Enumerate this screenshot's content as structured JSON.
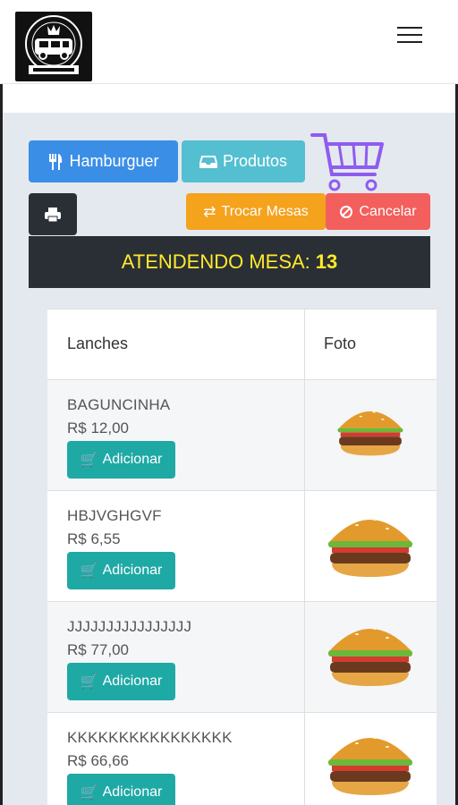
{
  "header": {
    "logo_icon": "food-truck-logo",
    "menu_icon": "hamburger-menu-icon"
  },
  "toolbar": {
    "hamburger_label": "Hamburguer",
    "produtos_label": "Produtos",
    "trocar_label": "Trocar Mesas",
    "cancelar_label": "Cancelar",
    "cart_icon": "shopping-cart-icon",
    "print_icon": "printer-icon"
  },
  "banner": {
    "label": "ATENDENDO MESA:",
    "table_number": "13"
  },
  "table": {
    "col_lanches": "Lanches",
    "col_foto": "Foto",
    "add_label": "Adicionar",
    "rows": [
      {
        "name": "BAGUNCINHA",
        "price": "R$ 12,00"
      },
      {
        "name": "HBJVGHGVF",
        "price": "R$ 6,55"
      },
      {
        "name": "JJJJJJJJJJJJJJJJ",
        "price": "R$ 77,00"
      },
      {
        "name": "KKKKKKKKKKKKKKKK",
        "price": "R$ 66,66"
      }
    ]
  },
  "colors": {
    "primary": "#3a8ee6",
    "info": "#54bfd1",
    "warning": "#f5a21d",
    "danger": "#f25f5c",
    "success": "#1fa9a5",
    "banner_text": "#ffea2b"
  }
}
